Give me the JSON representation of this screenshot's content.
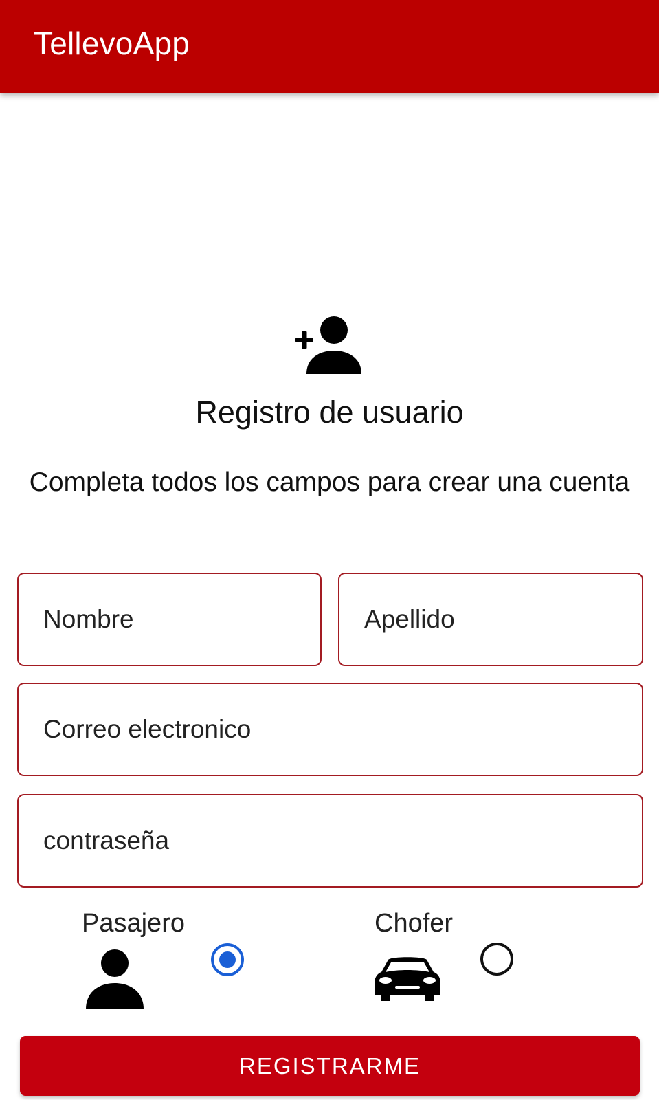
{
  "app_bar": {
    "title": "TellevoApp",
    "background_color": "#bb0000"
  },
  "header": {
    "icon": "add-user-icon",
    "title": "Registro de usuario",
    "subtitle": "Completa todos los campos para crear una cuenta"
  },
  "form": {
    "nombre": {
      "placeholder": "Nombre",
      "value": ""
    },
    "apellido": {
      "placeholder": "Apellido",
      "value": ""
    },
    "correo": {
      "placeholder": "Correo electronico",
      "value": ""
    },
    "password": {
      "placeholder": "contraseña",
      "value": ""
    },
    "border_color": "#a31b22"
  },
  "roles": {
    "pasajero": {
      "label": "Pasajero",
      "icon": "person-icon",
      "selected": true
    },
    "chofer": {
      "label": "Chofer",
      "icon": "car-icon",
      "selected": false
    },
    "selected_color": "#1a5fd6"
  },
  "submit": {
    "label": "REGISTRARME",
    "color": "#c4000e"
  }
}
